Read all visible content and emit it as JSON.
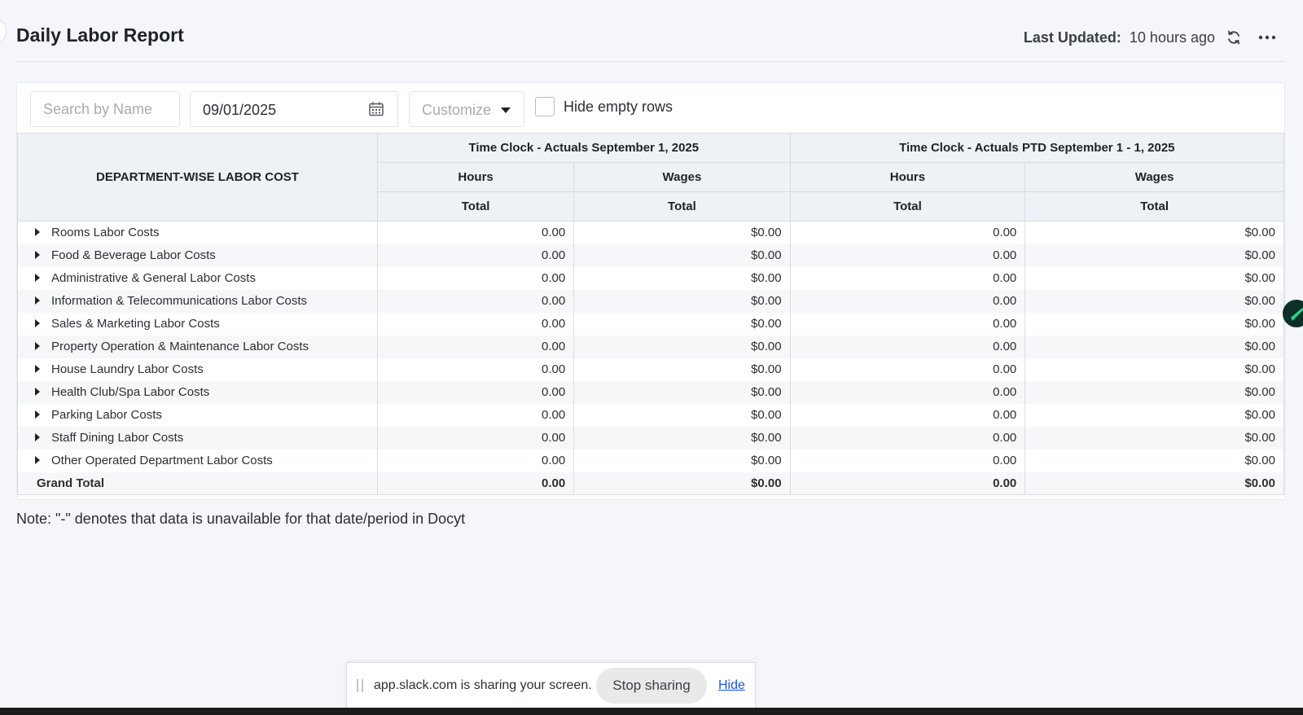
{
  "header": {
    "title": "Daily Labor Report",
    "last_updated_label": "Last Updated:",
    "last_updated_value": "10 hours ago"
  },
  "toolbar": {
    "search_placeholder": "Search by Name",
    "date_value": "09/01/2025",
    "customize_label": "Customize",
    "hide_empty_rows_label": "Hide empty rows",
    "hide_empty_rows_checked": false
  },
  "table": {
    "dept_header": "DEPARTMENT-WISE LABOR COST",
    "group1_header": "Time Clock - Actuals September 1, 2025",
    "group2_header": "Time Clock - Actuals PTD September 1 - 1, 2025",
    "hours_label": "Hours",
    "wages_label": "Wages",
    "total_label": "Total",
    "rows": [
      {
        "name": "Rooms Labor Costs",
        "hours": "0.00",
        "wages": "$0.00",
        "ptd_hours": "0.00",
        "ptd_wages": "$0.00"
      },
      {
        "name": "Food & Beverage Labor Costs",
        "hours": "0.00",
        "wages": "$0.00",
        "ptd_hours": "0.00",
        "ptd_wages": "$0.00"
      },
      {
        "name": "Administrative & General Labor Costs",
        "hours": "0.00",
        "wages": "$0.00",
        "ptd_hours": "0.00",
        "ptd_wages": "$0.00"
      },
      {
        "name": "Information & Telecommunications Labor Costs",
        "hours": "0.00",
        "wages": "$0.00",
        "ptd_hours": "0.00",
        "ptd_wages": "$0.00"
      },
      {
        "name": "Sales & Marketing Labor Costs",
        "hours": "0.00",
        "wages": "$0.00",
        "ptd_hours": "0.00",
        "ptd_wages": "$0.00"
      },
      {
        "name": "Property Operation & Maintenance Labor Costs",
        "hours": "0.00",
        "wages": "$0.00",
        "ptd_hours": "0.00",
        "ptd_wages": "$0.00"
      },
      {
        "name": "House Laundry Labor Costs",
        "hours": "0.00",
        "wages": "$0.00",
        "ptd_hours": "0.00",
        "ptd_wages": "$0.00"
      },
      {
        "name": "Health Club/Spa Labor Costs",
        "hours": "0.00",
        "wages": "$0.00",
        "ptd_hours": "0.00",
        "ptd_wages": "$0.00"
      },
      {
        "name": "Parking Labor Costs",
        "hours": "0.00",
        "wages": "$0.00",
        "ptd_hours": "0.00",
        "ptd_wages": "$0.00"
      },
      {
        "name": "Staff Dining Labor Costs",
        "hours": "0.00",
        "wages": "$0.00",
        "ptd_hours": "0.00",
        "ptd_wages": "$0.00"
      },
      {
        "name": "Other Operated Department Labor Costs",
        "hours": "0.00",
        "wages": "$0.00",
        "ptd_hours": "0.00",
        "ptd_wages": "$0.00"
      }
    ],
    "grand_total": {
      "name": "Grand Total",
      "hours": "0.00",
      "wages": "$0.00",
      "ptd_hours": "0.00",
      "ptd_wages": "$0.00"
    }
  },
  "note": "Note: \"-\" denotes that data is unavailable for that date/period in Docyt",
  "share_bar": {
    "text": "app.slack.com is sharing your screen.",
    "stop_label": "Stop sharing",
    "hide_label": "Hide"
  },
  "icons": {
    "refresh": "refresh-icon",
    "more": "more-horizontal-icon",
    "calendar": "calendar-icon",
    "caret": "caret-down-icon",
    "expand": "caret-right-icon"
  },
  "colors": {
    "background": "#f4f6f9",
    "header_cell": "#eef1f6",
    "link": "#1a56db"
  }
}
